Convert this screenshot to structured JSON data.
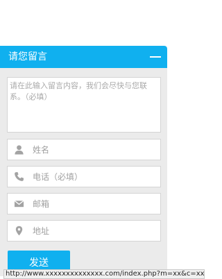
{
  "panel": {
    "title": "请您留言",
    "message_placeholder": "请在此输入留言内容，我们会尽快与您联系。（必填）",
    "name_placeholder": "姓名",
    "phone_placeholder": "电话（必填）",
    "email_placeholder": "邮箱",
    "address_placeholder": "地址",
    "send_label": "发送"
  },
  "icons": {
    "collapse": "minus-icon",
    "name": "user-icon",
    "phone": "phone-icon",
    "email": "envelope-icon",
    "address": "map-pin-icon"
  },
  "statusbar": {
    "url": "http://www.xxxxxxxxxxxxxx.com/index.php?m=xx&c=xx"
  },
  "colors": {
    "accent": "#10b0ef",
    "panel_bg": "#ebebeb",
    "icon_gray": "#a3a3a3"
  }
}
